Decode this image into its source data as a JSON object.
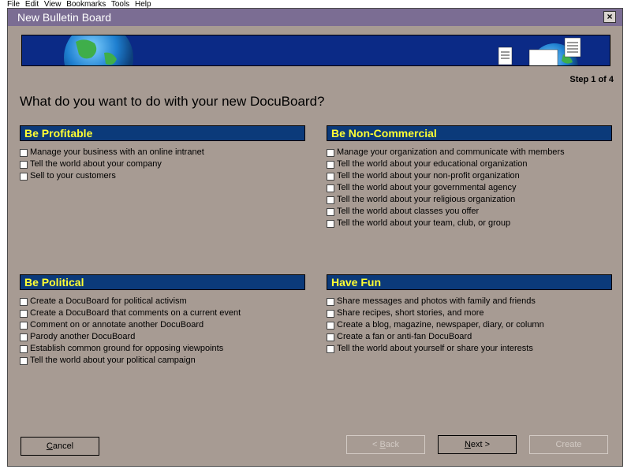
{
  "menubar": {
    "items": [
      "File",
      "Edit",
      "View",
      "Bookmarks",
      "Tools",
      "Help"
    ]
  },
  "window": {
    "title": "New Bulletin Board",
    "close_label": "×"
  },
  "step_text": "Step 1 of 4",
  "question": "What do you want to do with your new DocuBoard?",
  "sections": [
    {
      "title": "Be Profitable",
      "options": [
        "Manage your business with an online intranet",
        "Tell the world about your company",
        "Sell to your customers"
      ]
    },
    {
      "title": "Be Non-Commercial",
      "options": [
        "Manage your organization and communicate with members",
        "Tell the world about your educational organization",
        "Tell the world about your non-profit organization",
        "Tell the world about your governmental agency",
        "Tell the world about your religious organization",
        "Tell the world about classes you offer",
        "Tell the world about your team, club, or group"
      ]
    },
    {
      "title": "Be Political",
      "options": [
        "Create a DocuBoard for political activism",
        "Create a DocuBoard that comments on a current event",
        "Comment on or annotate another DocuBoard",
        "Parody another DocuBoard",
        "Establish common ground for opposing viewpoints",
        "Tell the world about your political campaign"
      ]
    },
    {
      "title": "Have Fun",
      "options": [
        "Share messages and photos with family and friends",
        "Share recipes, short stories, and more",
        "Create a blog, magazine, newspaper, diary, or column",
        "Create a fan or anti-fan DocuBoard",
        "Tell the world about yourself or share your interests"
      ]
    }
  ],
  "buttons": {
    "cancel": {
      "mnemonic": "C",
      "rest": "ancel"
    },
    "back": {
      "prefix": "< ",
      "mnemonic": "B",
      "rest": "ack"
    },
    "next": {
      "mnemonic": "N",
      "rest": "ext >"
    },
    "create": "Create"
  },
  "colors": {
    "window_bg": "#a79b93",
    "title_bar": "#7b6d93",
    "section_header_bg": "#0b3a7a",
    "section_header_text": "#ffff33",
    "banner_bg": "#0b2a86"
  },
  "icons": [
    "close-icon",
    "globe-icon",
    "document-icon",
    "checkbox-icon"
  ]
}
